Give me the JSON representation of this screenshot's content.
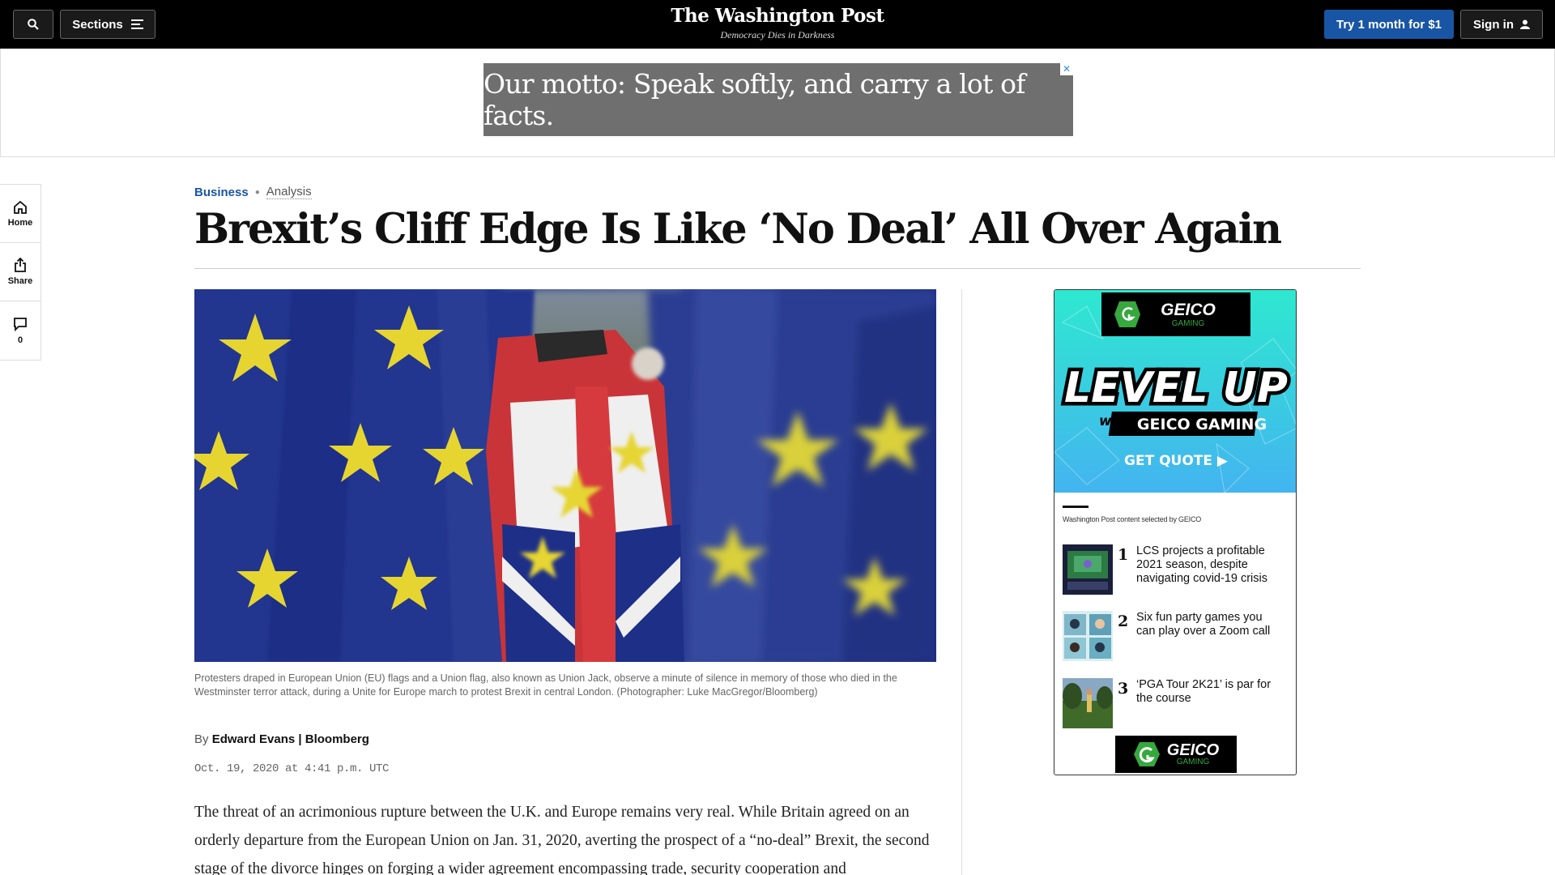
{
  "header": {
    "sections_label": "Sections",
    "logo": "The Washington Post",
    "tagline": "Democracy Dies in Darkness",
    "subscribe_label": "Try 1 month for $1",
    "signin_label": "Sign in"
  },
  "banner_ad": {
    "text": "Our motto: Speak softly, and carry a lot of facts.",
    "close_glyph": "✕"
  },
  "rail": {
    "home_label": "Home",
    "share_label": "Share",
    "comment_count": "0"
  },
  "article": {
    "section": "Business",
    "kicker_type": "Analysis",
    "headline": "Brexit’s Cliff Edge Is Like ‘No Deal’ All Over Again",
    "caption": "Protesters draped in European Union (EU) flags and a Union flag, also known as Union Jack, observe a minute of silence in memory of those who died in the Westminster terror attack, during a Unite for Europe march to protest Brexit in central London. (Photographer: Luke MacGregor/Bloomberg)",
    "byline_prefix": "By",
    "author": "Edward Evans | Bloomberg",
    "date": "Oct. 19, 2020 at 4:41 p.m. UTC",
    "body": "The threat of an acrimonious rupture between the U.K. and Europe remains very real. While Britain agreed on an orderly departure from the European Union on Jan. 31, 2020, averting the prospect of a “no-deal” Brexit, the second stage of the divorce hinges on forging a wider agreement encompassing trade, security cooperation and"
  },
  "sponsored": {
    "ad_brand": "GEICO",
    "ad_brand_sub": "GAMING",
    "ad_headline": "LEVEL UP",
    "ad_with": "with",
    "ad_product": "GEICO GAMING",
    "ad_cta": "GET QUOTE ▶",
    "selected_by": "Washington Post content selected by GEICO",
    "items": [
      {
        "num": "1",
        "title": "LCS projects a profitable 2021 season, despite navigating covid-19 crisis"
      },
      {
        "num": "2",
        "title": "Six fun party games you can play over a Zoom call"
      },
      {
        "num": "3",
        "title": "‘PGA Tour 2K21’ is par for the course"
      }
    ],
    "footer_brand": "GEICO",
    "footer_brand_sub": "GAMING"
  },
  "colors": {
    "accent_blue": "#1955a5",
    "eu_blue": "#1f2f8c",
    "eu_star": "#e6d530",
    "geico_green": "#36a83e",
    "ad_cyan": "#3fd0e6"
  }
}
